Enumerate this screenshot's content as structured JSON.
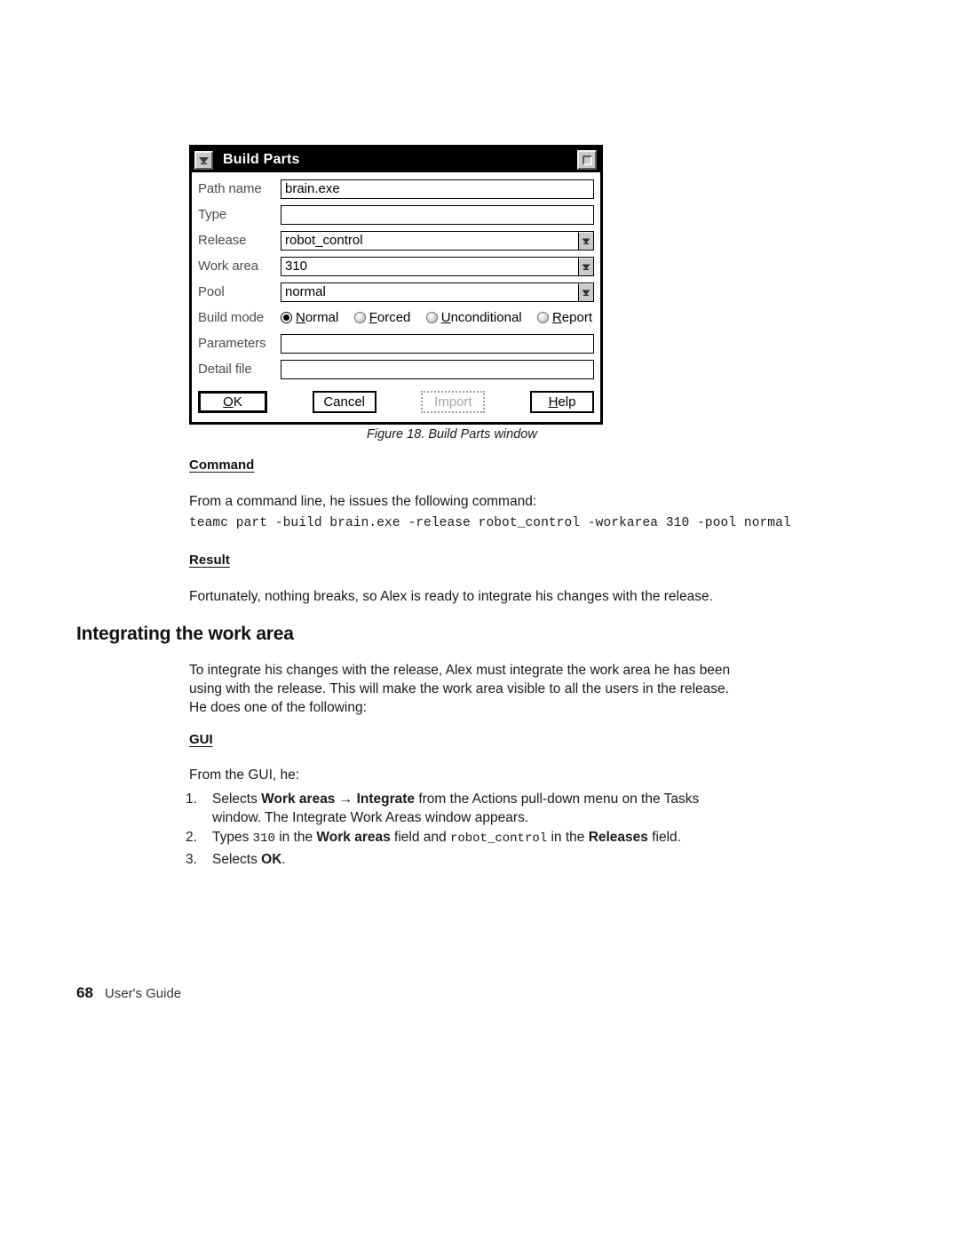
{
  "figure": {
    "caption": "Figure 18. Build Parts window",
    "dialog": {
      "title": "Build Parts",
      "window_menu_icon": "chevron-down-icon",
      "maximize_icon": "maximize-icon",
      "fields": [
        {
          "label": "Path name",
          "value": "brain.exe",
          "type": "text"
        },
        {
          "label": "Type",
          "value": "",
          "type": "text"
        },
        {
          "label": "Release",
          "value": "robot_control",
          "type": "combo"
        },
        {
          "label": "Work area",
          "value": "310",
          "type": "combo"
        },
        {
          "label": "Pool",
          "value": "normal",
          "type": "combo"
        }
      ],
      "build_mode": {
        "label": "Build mode",
        "options": [
          {
            "pre": "",
            "mnemonic": "N",
            "post": "ormal",
            "selected": true
          },
          {
            "pre": "",
            "mnemonic": "F",
            "post": "orced",
            "selected": false
          },
          {
            "pre": "",
            "mnemonic": "U",
            "post": "nconditional",
            "selected": false
          },
          {
            "pre": "",
            "mnemonic": "R",
            "post": "eport",
            "selected": false
          }
        ]
      },
      "bottom_fields": [
        {
          "label": "Parameters",
          "value": ""
        },
        {
          "label": "Detail file",
          "value": ""
        }
      ],
      "buttons": [
        {
          "pre": "",
          "mnemonic": "O",
          "post": "K",
          "state": "default"
        },
        {
          "pre": "Cancel",
          "mnemonic": "",
          "post": "",
          "state": "normal"
        },
        {
          "pre": "Import",
          "mnemonic": "",
          "post": "",
          "state": "disabled"
        },
        {
          "pre": "",
          "mnemonic": "H",
          "post": "elp",
          "state": "normal"
        }
      ]
    }
  },
  "content": {
    "command_heading": "Command",
    "command_intro": "From a command line, he issues the following command:",
    "command_line": "teamc part -build brain.exe -release robot_control -workarea 310 -pool normal",
    "result_heading": "Result",
    "result_text": "Fortunately, nothing breaks, so Alex is ready to integrate his changes with the release.",
    "section_heading": "Integrating the work area",
    "section_intro": "To integrate his changes with the release, Alex must integrate the work area he has been using with the release. This will make the work area visible to all the users in the release. He does one of the following:",
    "gui_heading": "GUI",
    "gui_intro": "From the GUI, he:",
    "steps": [
      {
        "number": "1.",
        "part1": "Selects ",
        "bold1": "Work areas",
        "arrow": "→",
        "bold2": "Integrate",
        "part2": " from the Actions pull-down menu on the Tasks window. The Integrate Work Areas window appears."
      },
      {
        "number": "2.",
        "part1": "Types ",
        "mono1": "310",
        "part2": " in the ",
        "bold1": "Work areas",
        "part3": " field and ",
        "mono2": "robot_control",
        "part4": " in the ",
        "bold2": "Releases",
        "part5": " field."
      },
      {
        "number": "3.",
        "part1": "Selects ",
        "bold1": "OK",
        "part2": "."
      }
    ]
  },
  "footer": {
    "page_number": "68",
    "book_title": "User's Guide"
  }
}
